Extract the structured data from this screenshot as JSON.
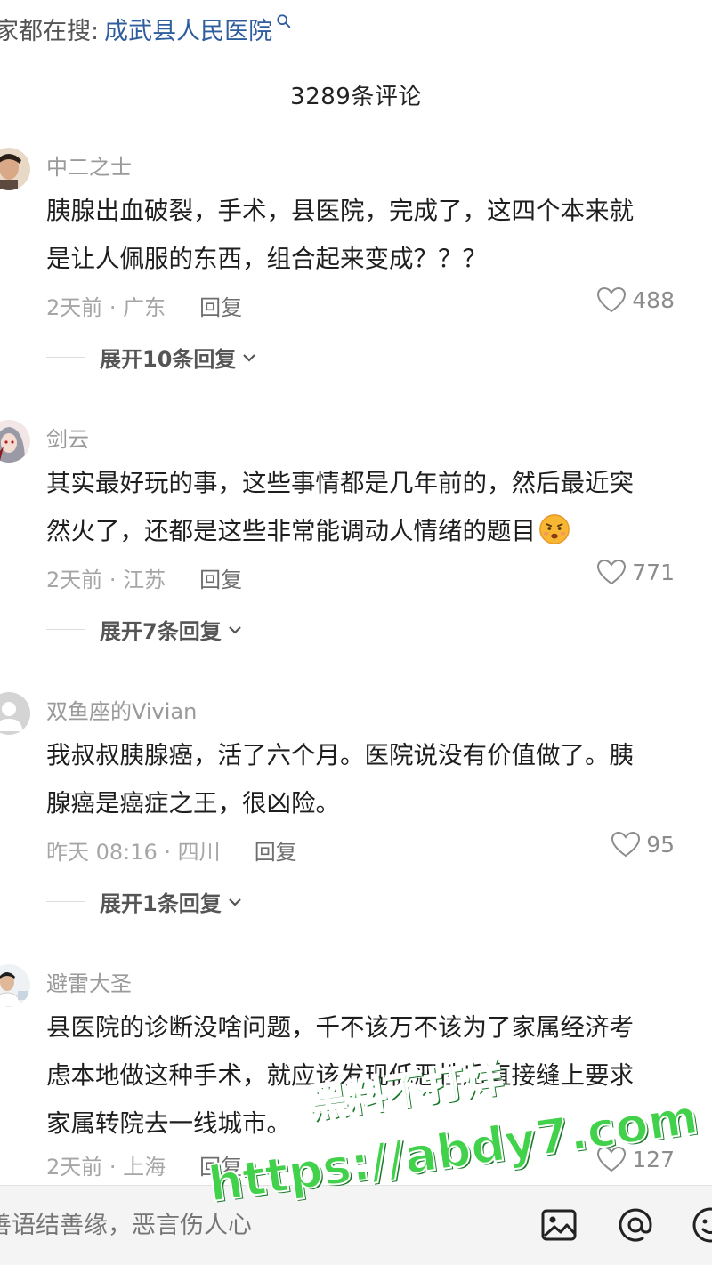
{
  "header": {
    "search_prefix": "家都在搜:",
    "search_term": "成武县人民医院",
    "comment_count": "3289条评论"
  },
  "comments": [
    {
      "username": "中二之士",
      "lines": [
        "胰腺出血破裂，手术，县医院，完成了，这四个本来就",
        "是让人佩服的东西，组合起来变成？？？"
      ],
      "time_location": "2天前 · 广东",
      "reply_label": "回复",
      "likes": "488",
      "expand_label": "展开10条回复"
    },
    {
      "username": "剑云",
      "lines": [
        "其实最好玩的事，这些事情都是几年前的，然后最近突",
        "然火了，还都是这些非常能调动人情绪的题目"
      ],
      "time_location": "2天前 · 江苏",
      "reply_label": "回复",
      "likes": "771",
      "expand_label": "展开7条回复"
    },
    {
      "username": "双鱼座的Vivian",
      "lines": [
        "我叔叔胰腺癌，活了六个月。医院说没有价值做了。胰",
        "腺癌是癌症之王，很凶险。"
      ],
      "time_location": "昨天 08:16 · 四川",
      "reply_label": "回复",
      "likes": "95",
      "expand_label": "展开1条回复"
    },
    {
      "username": "避雷大圣",
      "lines": [
        "县医院的诊断没啥问题，千不该万不该为了家属经济考",
        "虑本地做这种手术，就应该发现低恶性后直接缝上要求",
        "家属转院去一线城市。"
      ],
      "time_location": "2天前 · 上海",
      "reply_label": "回复",
      "likes": "127"
    }
  ],
  "bottom_bar": {
    "input_placeholder": "善语结善缘，恶言伤人心",
    "icons": [
      "image-icon",
      "at-icon",
      "emoji-icon"
    ]
  },
  "watermark": {
    "line1": "黑料不打烊",
    "line2": "https://abdy7.com"
  },
  "colors": {
    "link_blue": "#2f5e9e",
    "watermark_green": "#42d14a"
  }
}
